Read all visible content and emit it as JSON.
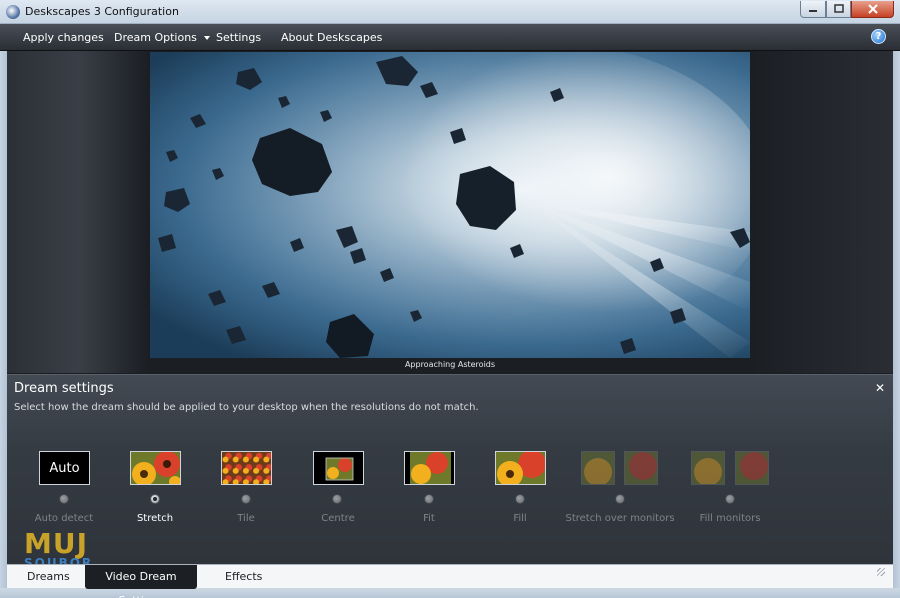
{
  "window": {
    "title": "Deskscapes 3 Configuration",
    "min_icon": "minimize-icon",
    "max_icon": "maximize-icon",
    "close_icon": "close-icon"
  },
  "menu": {
    "apply": "Apply changes",
    "dream_options": "Dream Options",
    "settings": "Settings",
    "about": "About Deskscapes",
    "help_symbol": "?"
  },
  "preview": {
    "caption": "Approaching Asteroids"
  },
  "dream_settings": {
    "title": "Dream settings",
    "description": "Select how the dream should be applied to your desktop when the resolutions do not match.",
    "close_symbol": "✕",
    "auto_text": "Auto",
    "options": [
      {
        "label": "Auto detect",
        "selected": false,
        "enabled": false
      },
      {
        "label": "Stretch",
        "selected": true,
        "enabled": true
      },
      {
        "label": "Tile",
        "selected": false,
        "enabled": false
      },
      {
        "label": "Centre",
        "selected": false,
        "enabled": false
      },
      {
        "label": "Fit",
        "selected": false,
        "enabled": false
      },
      {
        "label": "Fill",
        "selected": false,
        "enabled": false
      },
      {
        "label": "Stretch over monitors",
        "selected": false,
        "enabled": false
      },
      {
        "label": "Fill monitors",
        "selected": false,
        "enabled": false
      }
    ]
  },
  "tabs": {
    "dreams": "Dreams",
    "video_dream_settings": "Video Dream Settings",
    "effects": "Effects",
    "active": "Video Dream Settings"
  },
  "watermark": {
    "big": "MUJ",
    "small": "SOUBOR"
  },
  "colors": {
    "flower_petal": "#d9412a",
    "flower_yellow": "#f2b01e",
    "sky_light": "#dfeaf2",
    "sky_dark": "#1c3d59"
  }
}
